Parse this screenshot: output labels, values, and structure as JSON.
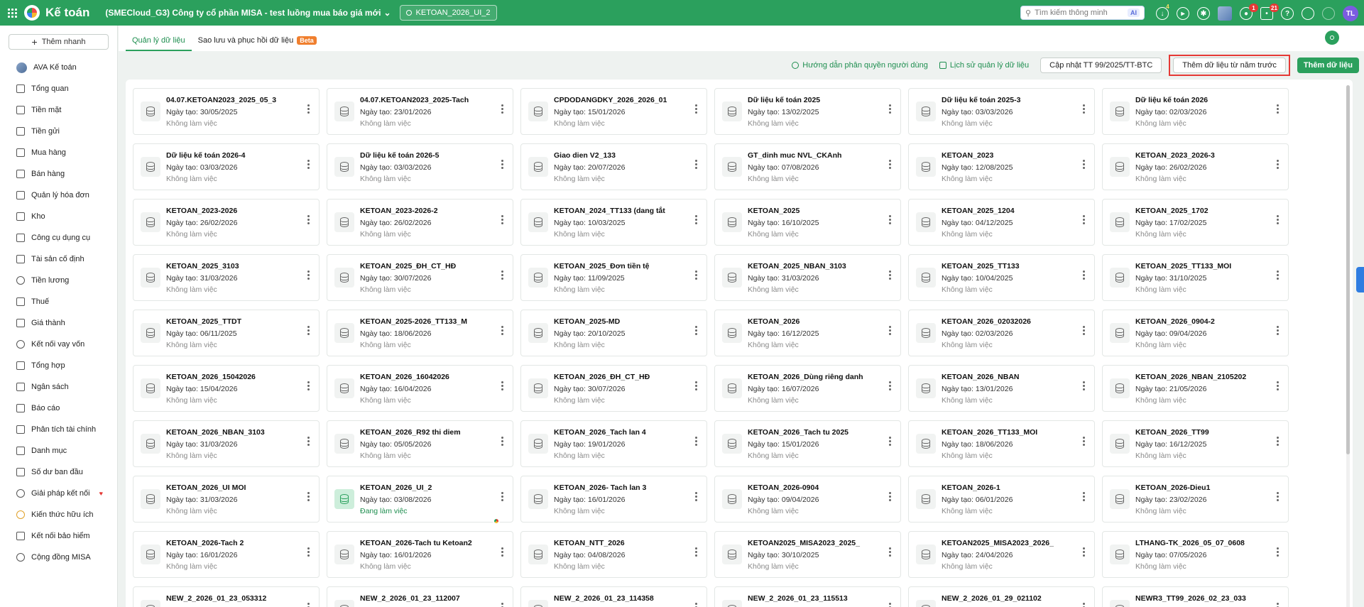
{
  "topbar": {
    "app_name": "Kế toán",
    "company": "(SMECloud_G3) Công ty cổ phần MISA - test luồng mua báo giá mới",
    "db_chip": "KETOAN_2026_UI_2",
    "search_placeholder": "Tìm kiếm thông minh",
    "search_ai": "AI",
    "download_badge": "4",
    "bell_badge": "1",
    "notif_badge": "21",
    "user_initials": "TL"
  },
  "sidebar": {
    "quick_add": "Thêm nhanh",
    "items": [
      {
        "label": "AVA Kế toán",
        "icon": "ava-icon"
      },
      {
        "label": "Tổng quan",
        "icon": "dashboard-icon"
      },
      {
        "label": "Tiền mặt",
        "icon": "cash-icon"
      },
      {
        "label": "Tiền gửi",
        "icon": "bank-icon"
      },
      {
        "label": "Mua hàng",
        "icon": "cart-icon"
      },
      {
        "label": "Bán hàng",
        "icon": "sales-icon"
      },
      {
        "label": "Quản lý hóa đơn",
        "icon": "invoice-icon"
      },
      {
        "label": "Kho",
        "icon": "warehouse-icon"
      },
      {
        "label": "Công cụ dụng cụ",
        "icon": "tools-icon"
      },
      {
        "label": "Tài sản cố định",
        "icon": "asset-icon"
      },
      {
        "label": "Tiền lương",
        "icon": "salary-icon"
      },
      {
        "label": "Thuế",
        "icon": "tax-icon"
      },
      {
        "label": "Giá thành",
        "icon": "price-tag-icon"
      },
      {
        "label": "Kết nối vay vốn",
        "icon": "loan-icon"
      },
      {
        "label": "Tổng hợp",
        "icon": "summary-icon"
      },
      {
        "label": "Ngân sách",
        "icon": "budget-icon"
      },
      {
        "label": "Báo cáo",
        "icon": "report-icon"
      },
      {
        "label": "Phân tích tài chính",
        "icon": "analysis-icon"
      },
      {
        "label": "Danh mục",
        "icon": "list-icon"
      },
      {
        "label": "Số dư ban đầu",
        "icon": "balance-icon"
      },
      {
        "label": "Giải pháp kết nối",
        "icon": "connect-icon"
      },
      {
        "label": "Kiến thức hữu ích",
        "icon": "bulb-icon"
      },
      {
        "label": "Kết nối bảo hiểm",
        "icon": "insurance-icon"
      },
      {
        "label": "Cộng đồng MISA",
        "icon": "community-icon"
      }
    ]
  },
  "tabs": [
    {
      "label": "Quản lý dữ liệu"
    },
    {
      "label": "Sao lưu và phục hồi dữ liệu",
      "badge": "Beta"
    }
  ],
  "actions": {
    "guide_link": "Hướng dẫn phân quyền người dùng",
    "history_link": "Lịch sử quản lý dữ liệu",
    "update_button": "Cập nhật TT 99/2025/TT-BTC",
    "add_prev_year_button": "Thêm dữ liệu từ năm trước",
    "add_data_button": "Thêm dữ liệu"
  },
  "cards": [
    {
      "name": "04.07.KETOAN2023_2025_05_3",
      "date": "Ngày tạo: 30/05/2025",
      "status": "Không làm việc"
    },
    {
      "name": "04.07.KETOAN2023_2025-Tach",
      "date": "Ngày tạo: 23/01/2026",
      "status": "Không làm việc"
    },
    {
      "name": "CPDODANGDKY_2026_2026_01",
      "date": "Ngày tạo: 15/01/2026",
      "status": "Không làm việc"
    },
    {
      "name": "Dữ liệu kế toán 2025",
      "date": "Ngày tạo: 13/02/2025",
      "status": "Không làm việc"
    },
    {
      "name": "Dữ liệu kế toán 2025-3",
      "date": "Ngày tạo: 03/03/2026",
      "status": "Không làm việc"
    },
    {
      "name": "Dữ liệu kế toán 2026",
      "date": "Ngày tạo: 02/03/2026",
      "status": "Không làm việc"
    },
    {
      "name": "Dữ liệu kế toán 2026-4",
      "date": "Ngày tạo: 03/03/2026",
      "status": "Không làm việc"
    },
    {
      "name": "Dữ liệu kế toán 2026-5",
      "date": "Ngày tạo: 03/03/2026",
      "status": "Không làm việc"
    },
    {
      "name": "Giao dien V2_133",
      "date": "Ngày tạo: 20/07/2026",
      "status": "Không làm việc"
    },
    {
      "name": "GT_dinh muc NVL_CKAnh",
      "date": "Ngày tạo: 07/08/2026",
      "status": "Không làm việc"
    },
    {
      "name": "KETOAN_2023",
      "date": "Ngày tạo: 12/08/2025",
      "status": "Không làm việc"
    },
    {
      "name": "KETOAN_2023_2026-3",
      "date": "Ngày tạo: 26/02/2026",
      "status": "Không làm việc"
    },
    {
      "name": "KETOAN_2023-2026",
      "date": "Ngày tạo: 26/02/2026",
      "status": "Không làm việc"
    },
    {
      "name": "KETOAN_2023-2026-2",
      "date": "Ngày tạo: 26/02/2026",
      "status": "Không làm việc"
    },
    {
      "name": "KETOAN_2024_TT133 (dang tắt",
      "date": "Ngày tạo: 10/03/2025",
      "status": "Không làm việc"
    },
    {
      "name": "KETOAN_2025",
      "date": "Ngày tạo: 16/10/2025",
      "status": "Không làm việc"
    },
    {
      "name": "KETOAN_2025_1204",
      "date": "Ngày tạo: 04/12/2025",
      "status": "Không làm việc"
    },
    {
      "name": "KETOAN_2025_1702",
      "date": "Ngày tạo: 17/02/2025",
      "status": "Không làm việc"
    },
    {
      "name": "KETOAN_2025_3103",
      "date": "Ngày tạo: 31/03/2026",
      "status": "Không làm việc"
    },
    {
      "name": "KETOAN_2025_ĐH_CT_HĐ",
      "date": "Ngày tạo: 30/07/2026",
      "status": "Không làm việc"
    },
    {
      "name": "KETOAN_2025_Đơn tiền tệ",
      "date": "Ngày tạo: 11/09/2025",
      "status": "Không làm việc"
    },
    {
      "name": "KETOAN_2025_NBAN_3103",
      "date": "Ngày tạo: 31/03/2026",
      "status": "Không làm việc"
    },
    {
      "name": "KETOAN_2025_TT133",
      "date": "Ngày tạo: 10/04/2025",
      "status": "Không làm việc"
    },
    {
      "name": "KETOAN_2025_TT133_MOI",
      "date": "Ngày tạo: 31/10/2025",
      "status": "Không làm việc"
    },
    {
      "name": "KETOAN_2025_TTDT",
      "date": "Ngày tạo: 06/11/2025",
      "status": "Không làm việc"
    },
    {
      "name": "KETOAN_2025-2026_TT133_M",
      "date": "Ngày tạo: 18/06/2026",
      "status": "Không làm việc"
    },
    {
      "name": "KETOAN_2025-MD",
      "date": "Ngày tạo: 20/10/2025",
      "status": "Không làm việc"
    },
    {
      "name": "KETOAN_2026",
      "date": "Ngày tạo: 16/12/2025",
      "status": "Không làm việc"
    },
    {
      "name": "KETOAN_2026_02032026",
      "date": "Ngày tạo: 02/03/2026",
      "status": "Không làm việc"
    },
    {
      "name": "KETOAN_2026_0904-2",
      "date": "Ngày tạo: 09/04/2026",
      "status": "Không làm việc"
    },
    {
      "name": "KETOAN_2026_15042026",
      "date": "Ngày tạo: 15/04/2026",
      "status": "Không làm việc"
    },
    {
      "name": "KETOAN_2026_16042026",
      "date": "Ngày tạo: 16/04/2026",
      "status": "Không làm việc"
    },
    {
      "name": "KETOAN_2026_ĐH_CT_HĐ",
      "date": "Ngày tạo: 30/07/2026",
      "status": "Không làm việc"
    },
    {
      "name": "KETOAN_2026_Dùng riêng danh",
      "date": "Ngày tạo: 16/07/2026",
      "status": "Không làm việc"
    },
    {
      "name": "KETOAN_2026_NBAN",
      "date": "Ngày tạo: 13/01/2026",
      "status": "Không làm việc"
    },
    {
      "name": "KETOAN_2026_NBAN_2105202",
      "date": "Ngày tạo: 21/05/2026",
      "status": "Không làm việc"
    },
    {
      "name": "KETOAN_2026_NBAN_3103",
      "date": "Ngày tạo: 31/03/2026",
      "status": "Không làm việc"
    },
    {
      "name": "KETOAN_2026_R92 thi diem",
      "date": "Ngày tạo: 05/05/2026",
      "status": "Không làm việc"
    },
    {
      "name": "KETOAN_2026_Tach lan 4",
      "date": "Ngày tạo: 19/01/2026",
      "status": "Không làm việc"
    },
    {
      "name": "KETOAN_2026_Tach tu 2025",
      "date": "Ngày tạo: 15/01/2026",
      "status": "Không làm việc"
    },
    {
      "name": "KETOAN_2026_TT133_MOI",
      "date": "Ngày tạo: 18/06/2026",
      "status": "Không làm việc"
    },
    {
      "name": "KETOAN_2026_TT99",
      "date": "Ngày tạo: 16/12/2025",
      "status": "Không làm việc"
    },
    {
      "name": "KETOAN_2026_UI MOI",
      "date": "Ngày tạo: 31/03/2026",
      "status": "Không làm việc"
    },
    {
      "name": "KETOAN_2026_UI_2",
      "date": "Ngày tạo: 03/08/2026",
      "status": "Đang làm việc",
      "active": true
    },
    {
      "name": "KETOAN_2026- Tach lan 3",
      "date": "Ngày tạo: 16/01/2026",
      "status": "Không làm việc"
    },
    {
      "name": "KETOAN_2026-0904",
      "date": "Ngày tạo: 09/04/2026",
      "status": "Không làm việc"
    },
    {
      "name": "KETOAN_2026-1",
      "date": "Ngày tạo: 06/01/2026",
      "status": "Không làm việc"
    },
    {
      "name": "KETOAN_2026-Dieu1",
      "date": "Ngày tạo: 23/02/2026",
      "status": "Không làm việc"
    },
    {
      "name": "KETOAN_2026-Tach 2",
      "date": "Ngày tạo: 16/01/2026",
      "status": "Không làm việc"
    },
    {
      "name": "KETOAN_2026-Tach tu Ketoan2",
      "date": "Ngày tạo: 16/01/2026",
      "status": "Không làm việc"
    },
    {
      "name": "KETOAN_NTT_2026",
      "date": "Ngày tạo: 04/08/2026",
      "status": "Không làm việc"
    },
    {
      "name": "KETOAN2025_MISA2023_2025_",
      "date": "Ngày tạo: 30/10/2025",
      "status": "Không làm việc"
    },
    {
      "name": "KETOAN2025_MISA2023_2026_",
      "date": "Ngày tạo: 24/04/2026",
      "status": "Không làm việc"
    },
    {
      "name": "LTHANG-TK_2026_05_07_0608",
      "date": "Ngày tạo: 07/05/2026",
      "status": "Không làm việc"
    },
    {
      "name": "NEW_2_2026_01_23_053312",
      "date": "",
      "status": ""
    },
    {
      "name": "NEW_2_2026_01_23_112007",
      "date": "",
      "status": ""
    },
    {
      "name": "NEW_2_2026_01_23_114358",
      "date": "",
      "status": ""
    },
    {
      "name": "NEW_2_2026_01_23_115513",
      "date": "",
      "status": ""
    },
    {
      "name": "NEW_2_2026_01_29_021102",
      "date": "",
      "status": ""
    },
    {
      "name": "NEWR3_TT99_2026_02_23_033",
      "date": "",
      "status": ""
    }
  ],
  "colors": {
    "brand_green": "#2ba05d",
    "highlight_red": "#e53935",
    "active_status": "#1e8e4f"
  }
}
